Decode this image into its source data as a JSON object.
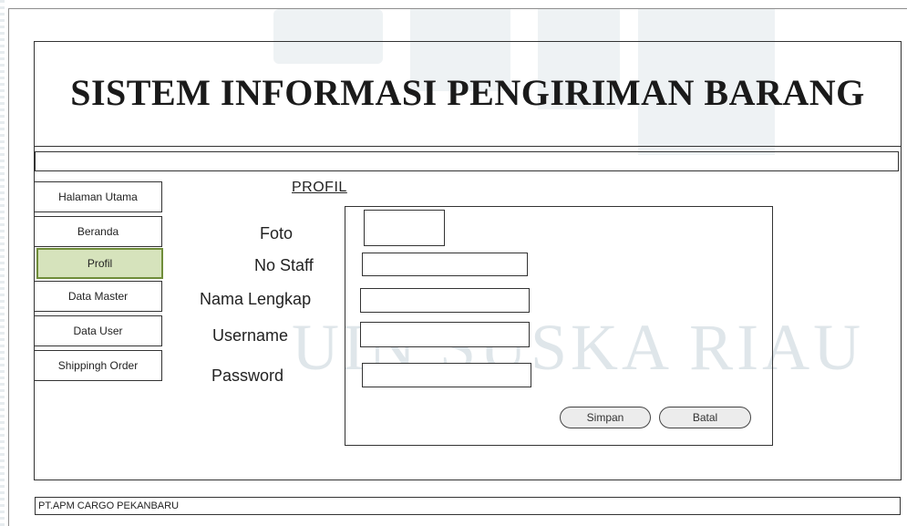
{
  "app": {
    "title": "SISTEM INFORMASI PENGIRIMAN BARANG"
  },
  "watermark": {
    "text": "UIN SUSKA RIAU"
  },
  "sidebar": {
    "items": [
      {
        "label": "Halaman Utama",
        "active": false
      },
      {
        "label": "Beranda",
        "active": false
      },
      {
        "label": "Profil",
        "active": true
      },
      {
        "label": "Data Master",
        "active": false
      },
      {
        "label": "Data User",
        "active": false
      },
      {
        "label": "Shippingh Order",
        "active": false
      }
    ]
  },
  "form": {
    "title": "PROFIL",
    "labels": {
      "foto": "Foto",
      "no_staff": "No Staff",
      "nama_lengkap": "Nama Lengkap",
      "username": "Username",
      "password": "Password"
    },
    "values": {
      "no_staff": "",
      "nama_lengkap": "",
      "username": "",
      "password": ""
    },
    "buttons": {
      "save": "Simpan",
      "cancel": "Batal"
    }
  },
  "footer": {
    "text": "PT.APM CARGO PEKANBARU"
  },
  "colors": {
    "active_nav_fill": "#d6e3bc",
    "active_nav_border": "#6f8d3a",
    "button_fill": "#ececec",
    "border": "#333333"
  }
}
